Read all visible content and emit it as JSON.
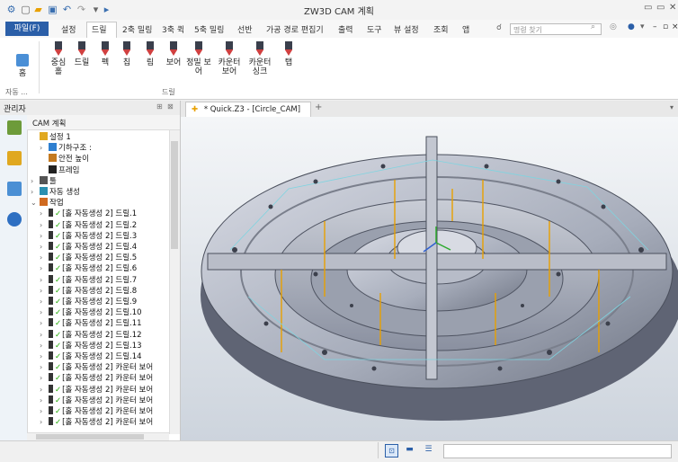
{
  "window": {
    "title": "ZW3D CAM 계획"
  },
  "menu": {
    "file": "파일(F)",
    "tabs": [
      "설정",
      "드릴",
      "2축 밀링",
      "3축 퀵",
      "5축 밀링",
      "선반",
      "가공 경로 편집기",
      "출력",
      "도구",
      "뷰 설정",
      "조회",
      "앱"
    ],
    "search_placeholder": "명령 찾기"
  },
  "ribbon": {
    "buttons": [
      {
        "label": "홈",
        "icon": "home-icon"
      },
      {
        "label": "중심\n홀",
        "icon": "center-drill-icon"
      },
      {
        "label": "드릴",
        "icon": "drill-icon"
      },
      {
        "label": "펙",
        "icon": "peck-drill-icon"
      },
      {
        "label": "칩",
        "icon": "chip-break-icon"
      },
      {
        "label": "림",
        "icon": "ream-icon"
      },
      {
        "label": "보어",
        "icon": "bore-icon"
      },
      {
        "label": "정밀 보\n어",
        "icon": "fine-bore-icon"
      },
      {
        "label": "카운터\n보어",
        "icon": "counterbore-icon"
      },
      {
        "label": "카운터\n싱크",
        "icon": "countersink-icon"
      },
      {
        "label": "탭",
        "icon": "tap-icon"
      }
    ],
    "groups": {
      "auto": "자동 ...",
      "drill": "드릴"
    }
  },
  "manager": {
    "title": "관리자",
    "cam_title": "CAM 계획",
    "tree": [
      {
        "label": "설정 1",
        "indent": 0,
        "arrow": "",
        "icon": "setup"
      },
      {
        "label": "기하구조 :",
        "indent": 1,
        "arrow": ">",
        "icon": "geometry"
      },
      {
        "label": "안전 높이",
        "indent": 1,
        "arrow": "",
        "icon": "safe"
      },
      {
        "label": "프레임",
        "indent": 1,
        "arrow": "",
        "icon": "frame"
      },
      {
        "label": "툴",
        "indent": 0,
        "arrow": ">",
        "icon": "tool"
      },
      {
        "label": "자동 생성",
        "indent": 0,
        "arrow": ">",
        "icon": "auto"
      },
      {
        "label": "작업",
        "indent": 0,
        "arrow": "v",
        "icon": "ops"
      },
      {
        "label": "[홀 자동생성 2] 드릴.1",
        "indent": 1,
        "arrow": ">",
        "icon": "drill",
        "check": true
      },
      {
        "label": "[홀 자동생성 2] 드릴.2",
        "indent": 1,
        "arrow": ">",
        "icon": "drill",
        "check": true
      },
      {
        "label": "[홀 자동생성 2] 드릴.3",
        "indent": 1,
        "arrow": ">",
        "icon": "drill",
        "check": true
      },
      {
        "label": "[홀 자동생성 2] 드릴.4",
        "indent": 1,
        "arrow": ">",
        "icon": "drill",
        "check": true
      },
      {
        "label": "[홀 자동생성 2] 드릴.5",
        "indent": 1,
        "arrow": ">",
        "icon": "drill",
        "check": true
      },
      {
        "label": "[홀 자동생성 2] 드릴.6",
        "indent": 1,
        "arrow": ">",
        "icon": "drill",
        "check": true
      },
      {
        "label": "[홀 자동생성 2] 드릴.7",
        "indent": 1,
        "arrow": ">",
        "icon": "drill",
        "check": true
      },
      {
        "label": "[홀 자동생성 2] 드릴.8",
        "indent": 1,
        "arrow": ">",
        "icon": "drill",
        "check": true
      },
      {
        "label": "[홀 자동생성 2] 드릴.9",
        "indent": 1,
        "arrow": ">",
        "icon": "drill",
        "check": true
      },
      {
        "label": "[홀 자동생성 2] 드릴.10",
        "indent": 1,
        "arrow": ">",
        "icon": "drill",
        "check": true
      },
      {
        "label": "[홀 자동생성 2] 드릴.11",
        "indent": 1,
        "arrow": ">",
        "icon": "drill",
        "check": true
      },
      {
        "label": "[홀 자동생성 2] 드릴.12",
        "indent": 1,
        "arrow": ">",
        "icon": "drill",
        "check": true
      },
      {
        "label": "[홀 자동생성 2] 드릴.13",
        "indent": 1,
        "arrow": ">",
        "icon": "drill",
        "check": true
      },
      {
        "label": "[홀 자동생성 2] 드릴.14",
        "indent": 1,
        "arrow": ">",
        "icon": "drill",
        "check": true
      },
      {
        "label": "[홀 자동생성 2] 카운터 보어",
        "indent": 1,
        "arrow": ">",
        "icon": "cbore",
        "check": true
      },
      {
        "label": "[홀 자동생성 2] 카운터 보어",
        "indent": 1,
        "arrow": ">",
        "icon": "cbore",
        "check": true
      },
      {
        "label": "[홀 자동생성 2] 카운터 보어",
        "indent": 1,
        "arrow": ">",
        "icon": "cbore",
        "check": true
      },
      {
        "label": "[홀 자동생성 2] 카운터 보어",
        "indent": 1,
        "arrow": ">",
        "icon": "cbore",
        "check": true
      },
      {
        "label": "[홀 자동생성 2] 카운터 보어",
        "indent": 1,
        "arrow": ">",
        "icon": "cbore",
        "check": true
      },
      {
        "label": "[홀 자동생성 2] 카운터 보어",
        "indent": 1,
        "arrow": ">",
        "icon": "cbore",
        "check": true
      }
    ]
  },
  "document": {
    "tab_label": "* Quick.Z3 - [Circle_CAM]"
  },
  "colors": {
    "accent": "#2b5fa8",
    "check": "#1faa00",
    "toolpath": "#e8a000",
    "part": "#9aa0ae"
  }
}
